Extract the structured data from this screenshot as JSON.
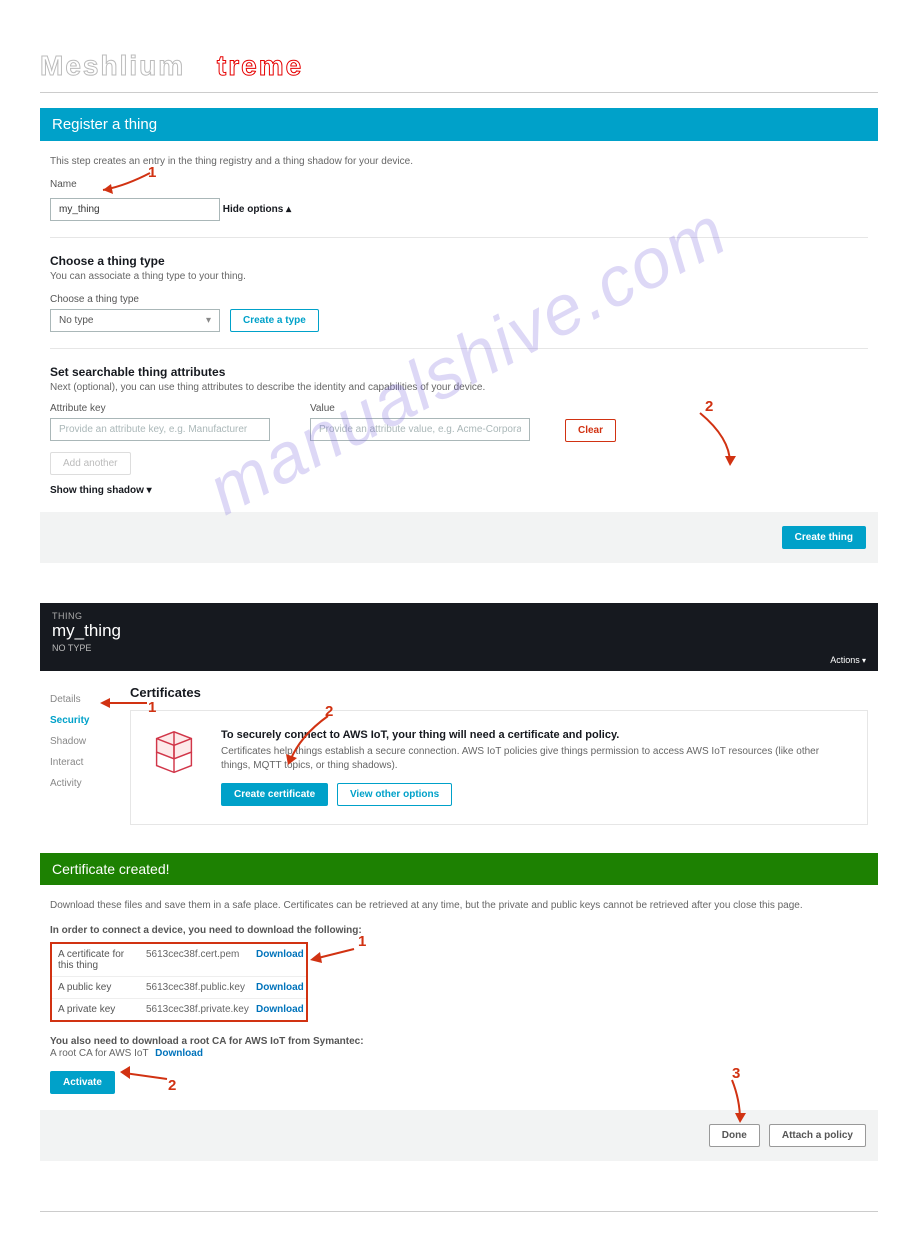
{
  "masthead": {
    "title_a": "Meshlium",
    "title_b": "treme"
  },
  "watermark": "manualshive.com",
  "register": {
    "banner": "Register a thing",
    "intro": "This step creates an entry in the thing registry and a thing shadow for your device.",
    "name_label": "Name",
    "name_value": "my_thing",
    "hide_options": "Hide options",
    "thing_type_head": "Choose a thing type",
    "thing_type_desc": "You can associate a thing type to your thing.",
    "thing_type_label": "Choose a thing type",
    "thing_type_selected": "No type",
    "create_type": "Create a type",
    "attr_head": "Set searchable thing attributes",
    "attr_desc": "Next (optional), you can use thing attributes to describe the identity and capabilities of your device.",
    "attr_key_label": "Attribute key",
    "attr_key_placeholder": "Provide an attribute key, e.g. Manufacturer",
    "attr_value_label": "Value",
    "attr_value_placeholder": "Provide an attribute value, e.g. Acme-Corporation",
    "clear": "Clear",
    "add_another": "Add another",
    "show_shadow": "Show thing shadow",
    "create_thing": "Create thing"
  },
  "thing_detail": {
    "eyebrow": "THING",
    "name": "my_thing",
    "notype": "NO TYPE",
    "actions": "Actions",
    "sidebar": {
      "details": "Details",
      "security": "Security",
      "shadow": "Shadow",
      "interact": "Interact",
      "activity": "Activity"
    },
    "cert_head": "Certificates",
    "card_title": "To securely connect to AWS IoT, your thing will need a certificate and policy.",
    "card_desc": "Certificates help things establish a secure connection. AWS IoT policies give things permission to access AWS IoT resources (like other things, MQTT topics, or thing shadows).",
    "create_cert": "Create certificate",
    "view_other": "View other options"
  },
  "cert_created": {
    "banner": "Certificate created!",
    "intro": "Download these files and save them in a safe place. Certificates can be retrieved at any time, but the private and public keys cannot be retrieved after you close this page.",
    "table_header": "In order to connect a device, you need to download the following:",
    "rows": [
      {
        "label": "A certificate for this thing",
        "file": "5613cec38f.cert.pem",
        "dl": "Download"
      },
      {
        "label": "A public key",
        "file": "5613cec38f.public.key",
        "dl": "Download"
      },
      {
        "label": "A private key",
        "file": "5613cec38f.private.key",
        "dl": "Download"
      }
    ],
    "root_ca_text_a": "You also need to download a root CA for AWS IoT from Symantec:",
    "root_ca_text_b": "A root CA for AWS IoT",
    "root_ca_link": "Download",
    "activate": "Activate",
    "done": "Done",
    "attach_policy": "Attach a policy"
  },
  "annotations": {
    "n1": "1",
    "n2": "2",
    "n3": "3"
  }
}
